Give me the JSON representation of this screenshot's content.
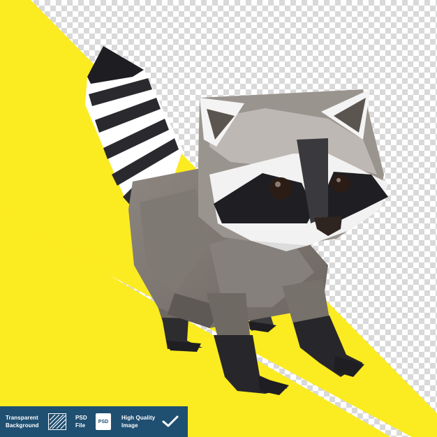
{
  "badge": {
    "transparent_line1": "Transparent",
    "transparent_line2": "Background",
    "psd_line1": "PSD",
    "psd_line2": "File",
    "psd_icon_text": "PSD",
    "quality_line1": "High Quality",
    "quality_line2": "Image"
  },
  "colors": {
    "yellow": "#fbeb21",
    "checker_light": "#ffffff",
    "checker_dark": "#d9d9d9",
    "badge_bg": "#1f4f71"
  },
  "icons": [
    "hatch-icon",
    "psd-file-icon",
    "checkmark-icon"
  ]
}
